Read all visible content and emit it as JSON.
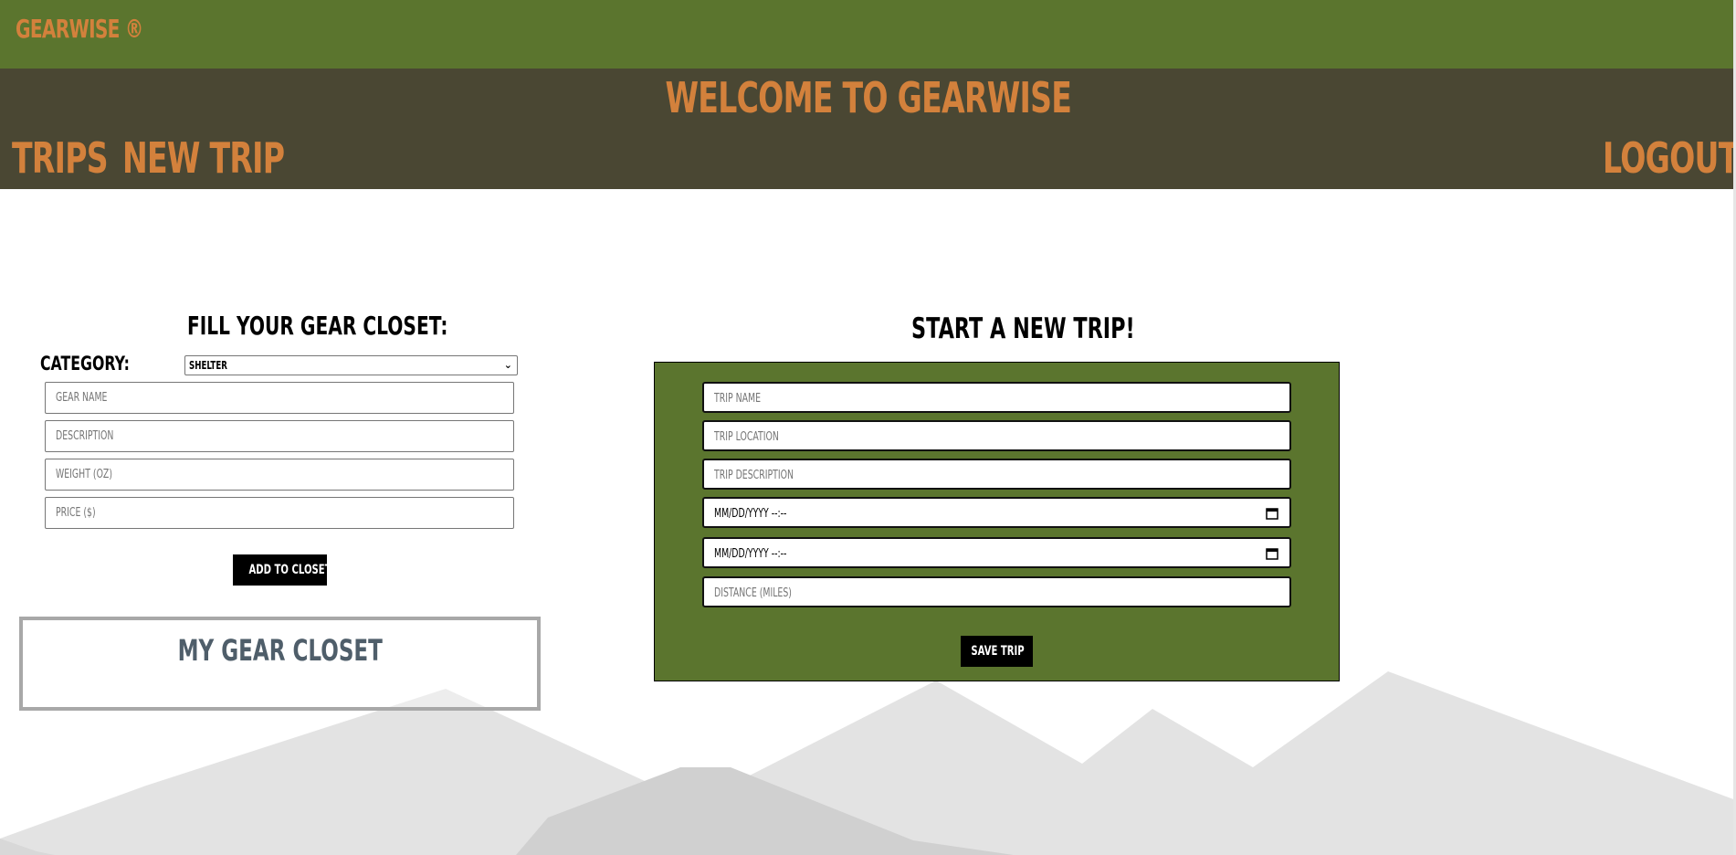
{
  "header": {
    "brand": "GEARWISE ®",
    "welcome": "WELCOME TO GEARWISE",
    "nav": {
      "trips": "TRIPS",
      "new_trip": "NEW TRIP",
      "logout": "LOGOUT"
    }
  },
  "gear_form": {
    "heading": "FILL YOUR GEAR CLOSET:",
    "category_label": "CATEGORY:",
    "category_value": "SHELTER",
    "gear_name_placeholder": "GEAR NAME",
    "description_placeholder": "DESCRIPTION",
    "weight_placeholder": "WEIGHT (OZ)",
    "price_placeholder": "PRICE ($)",
    "add_button": "ADD TO CLOSET"
  },
  "gear_closet": {
    "title": "MY GEAR CLOSET"
  },
  "trip_form": {
    "heading": "START A NEW TRIP!",
    "trip_name_placeholder": "TRIP NAME",
    "trip_location_placeholder": "TRIP LOCATION",
    "trip_description_placeholder": "TRIP DESCRIPTION",
    "start_date_placeholder": "MM/DD/YYYY --:--",
    "end_date_placeholder": "MM/DD/YYYY --:--",
    "distance_placeholder": "DISTANCE (MILES)",
    "save_button": "SAVE TRIP"
  },
  "colors": {
    "top_bar": "#5b752e",
    "nav_bar": "#4a4733",
    "accent": "#d3813c",
    "panel": "#5b752e",
    "closet_title": "#4f5e6a"
  }
}
